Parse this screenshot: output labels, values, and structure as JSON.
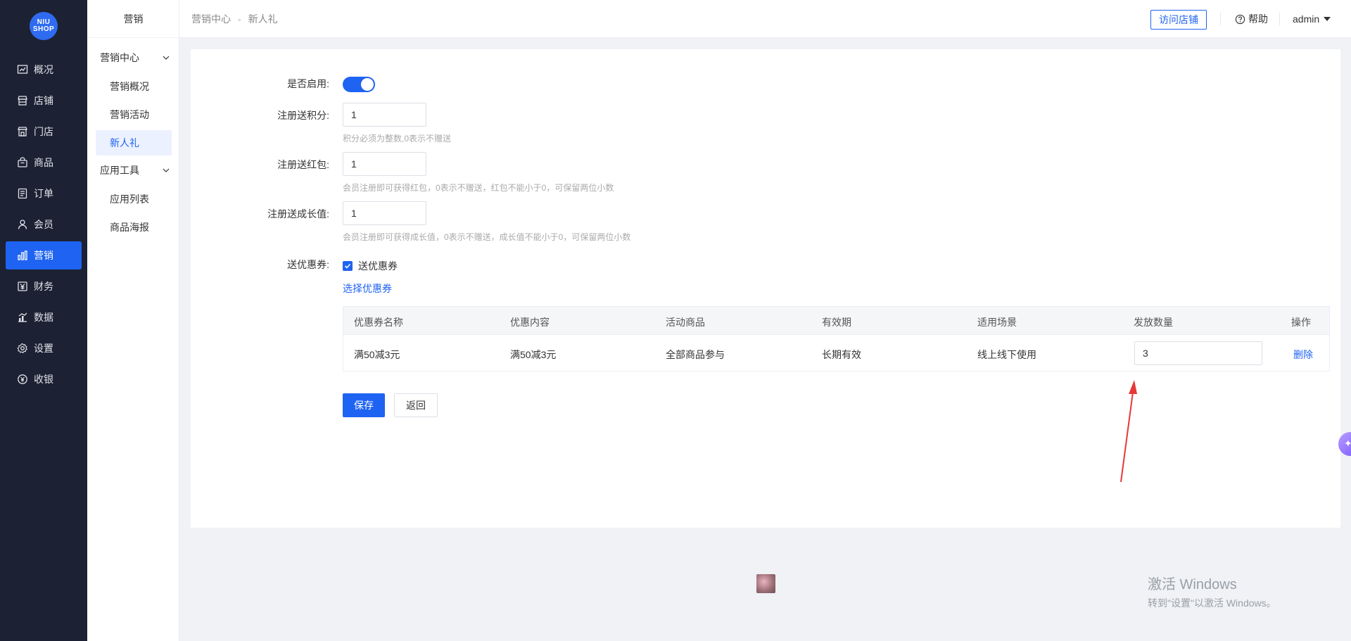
{
  "logo": {
    "line1": "NIU",
    "line2": "SHOP"
  },
  "main_menu": [
    {
      "label": "概况",
      "icon": "chart-line-icon"
    },
    {
      "label": "店铺",
      "icon": "store-icon"
    },
    {
      "label": "门店",
      "icon": "shop-front-icon"
    },
    {
      "label": "商品",
      "icon": "bag-icon"
    },
    {
      "label": "订单",
      "icon": "order-list-icon"
    },
    {
      "label": "会员",
      "icon": "user-icon"
    },
    {
      "label": "营销",
      "icon": "bar-chart-icon",
      "active": true
    },
    {
      "label": "财务",
      "icon": "yuan-icon"
    },
    {
      "label": "数据",
      "icon": "data-chart-icon"
    },
    {
      "label": "设置",
      "icon": "gear-icon"
    },
    {
      "label": "收银",
      "icon": "cashier-icon"
    }
  ],
  "sub_menu": {
    "title": "营销",
    "groups": [
      {
        "label": "营销中心",
        "items": [
          "营销概况",
          "营销活动",
          "新人礼"
        ]
      },
      {
        "label": "应用工具",
        "items": [
          "应用列表",
          "商品海报"
        ]
      }
    ],
    "active_item": "新人礼"
  },
  "header": {
    "breadcrumb": [
      "营销中心",
      "新人礼"
    ],
    "breadcrumb_sep": "-",
    "visit_store": "访问店铺",
    "help": "帮助",
    "user": "admin"
  },
  "form": {
    "enable_label": "是否启用:",
    "enabled": true,
    "points_label": "注册送积分:",
    "points_value": "1",
    "points_hint": "积分必须为整数,0表示不赠送",
    "redpacket_label": "注册送红包:",
    "redpacket_value": "1",
    "redpacket_hint": "会员注册即可获得红包，0表示不赠送，红包不能小于0，可保留两位小数",
    "growth_label": "注册送成长值:",
    "growth_value": "1",
    "growth_hint": "会员注册即可获得成长值，0表示不赠送，成长值不能小于0，可保留两位小数",
    "coupon_label": "送优惠券:",
    "coupon_check_label": "送优惠券",
    "coupon_checked": true,
    "select_coupon": "选择优惠券"
  },
  "coupon_table": {
    "headers": [
      "优惠券名称",
      "优惠内容",
      "活动商品",
      "有效期",
      "适用场景",
      "发放数量",
      "操作"
    ],
    "rows": [
      {
        "name": "满50减3元",
        "content": "满50减3元",
        "goods": "全部商品参与",
        "validity": "长期有效",
        "scene": "线上线下使用",
        "quantity": "3",
        "action": "删除"
      }
    ]
  },
  "buttons": {
    "save": "保存",
    "back": "返回"
  },
  "watermark": {
    "line1": "激活 Windows",
    "line2": "转到\"设置\"以激活 Windows。"
  },
  "colors": {
    "primary": "#1f63f2",
    "sidebar": "#1c2233",
    "annotation_arrow": "#e53935"
  }
}
